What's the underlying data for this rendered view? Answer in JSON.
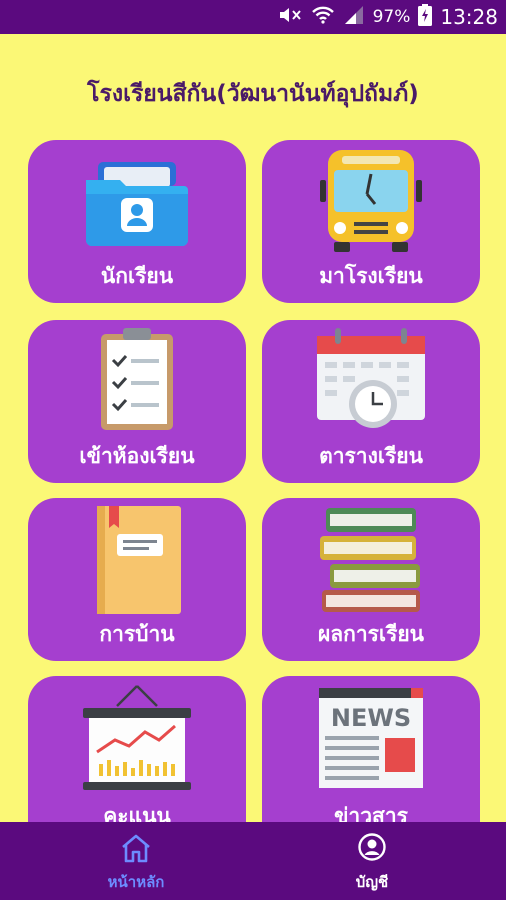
{
  "status_bar": {
    "battery": "97%",
    "time": "13:28",
    "icons": [
      "mute-icon",
      "wifi-icon",
      "signal-icon",
      "battery-charging-icon"
    ]
  },
  "app": {
    "title": "โรงเรียนสีกัน(วัฒนานันท์อุปถัมภ์)"
  },
  "menu": [
    {
      "label": "นักเรียน",
      "icon": "student-folder-icon"
    },
    {
      "label": "มาโรงเรียน",
      "icon": "school-bus-icon"
    },
    {
      "label": "เข้าห้องเรียน",
      "icon": "checklist-clipboard-icon"
    },
    {
      "label": "ตารางเรียน",
      "icon": "calendar-clock-icon"
    },
    {
      "label": "การบ้าน",
      "icon": "notebook-icon"
    },
    {
      "label": "ผลการเรียน",
      "icon": "books-stack-icon"
    },
    {
      "label": "คะแนน",
      "icon": "chart-board-icon"
    },
    {
      "label": "ข่าวสาร",
      "icon": "newspaper-icon"
    }
  ],
  "bottom_nav": {
    "home": {
      "label": "หน้าหลัก",
      "icon": "home-icon",
      "active": true
    },
    "account": {
      "label": "บัญชี",
      "icon": "account-icon",
      "active": false
    }
  },
  "colors": {
    "background": "#fbf876",
    "bars": "#5b0a7f",
    "tile": "#a53fcf",
    "nav_active": "#6d8cff"
  }
}
